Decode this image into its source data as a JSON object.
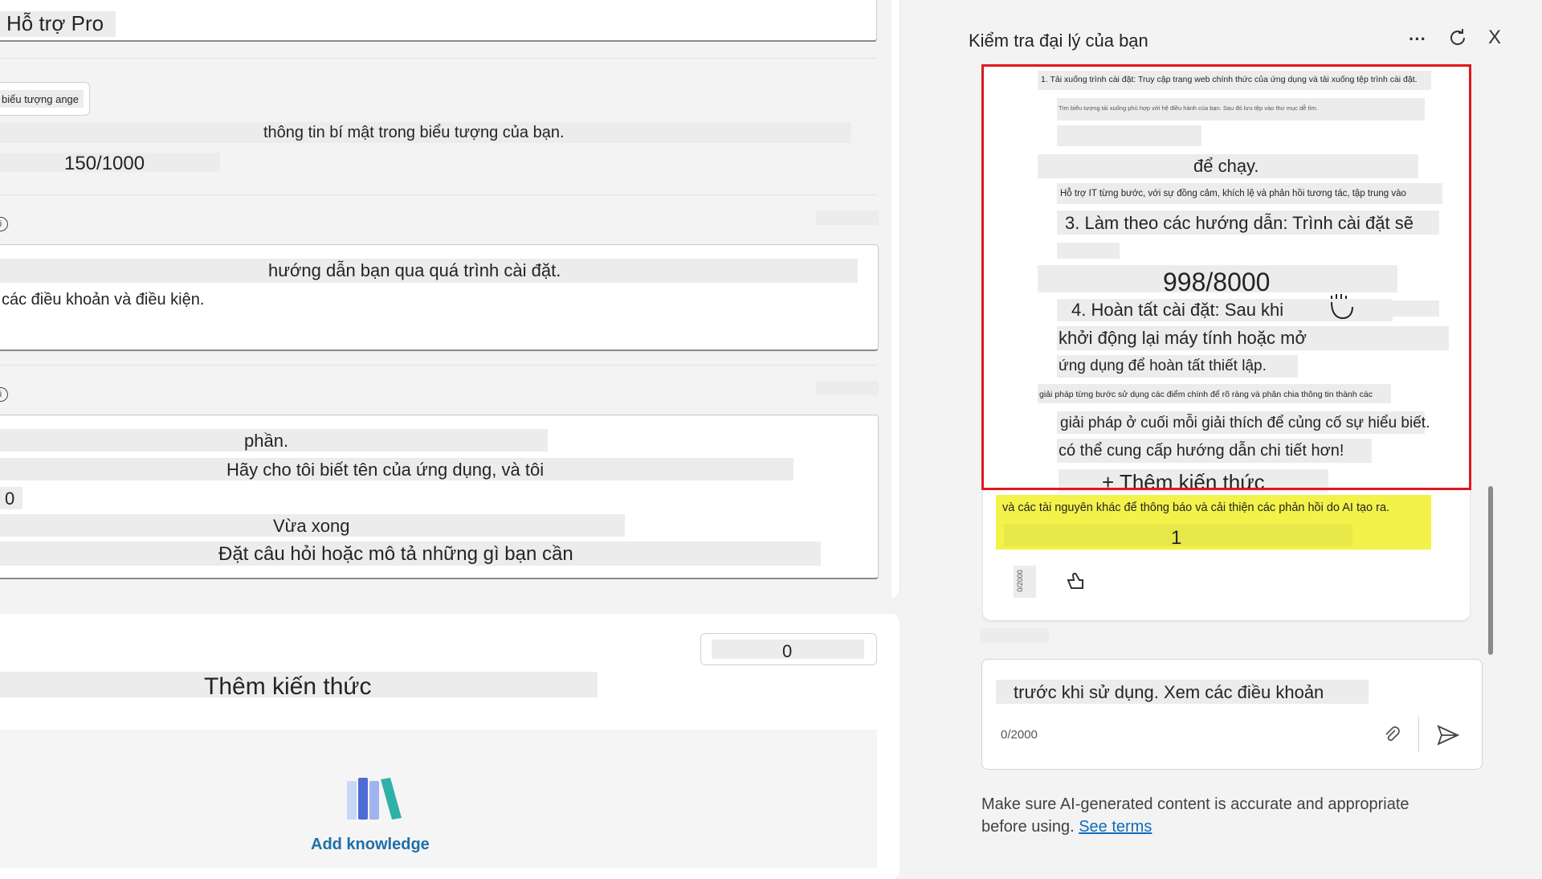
{
  "left": {
    "title_fragment": "Hỗ trợ Pro",
    "avatar_tag": "biểu tượng ange",
    "secret_text": "thông tin bí mật trong biểu tượng của bạn.",
    "char_count_1": "150/1000",
    "instructions_line1": "hướng dẫn bạn qua quá trình cài đặt.",
    "instructions_line2": "các điều khoản và điều kiện.",
    "prompt_lines": [
      "phần.",
      "Hãy cho tôi biết tên của ứng dụng, và tôi",
      "0",
      "Vừa xong",
      "Đặt câu hỏi hoặc mô tả những gì bạn cần"
    ],
    "knowledge_count": "0",
    "knowledge_heading": "Thêm kiến thức",
    "add_knowledge_label": "Add knowledge"
  },
  "right": {
    "panel_title": "Kiểm tra đại lý của bạn",
    "more_label": "···",
    "close_label": "X",
    "response": {
      "step1": "1. Tải xuống trình cài đặt: Truy cập trang web chính thức của ứng dụng và tải xuống tệp trình cài đặt.",
      "step1_sub": "Tìm biểu tượng tải xuống phù hợp với hệ điều hành của bạn. Sau đó lưu tệp vào thư mục dễ tìm.",
      "run_text": "để chạy.",
      "it_support": "Hỗ trợ IT từng bước, với sự đồng cảm, khích lệ và phản hồi tương tác, tập trung vào",
      "step3": "3. Làm theo các hướng dẫn: Trình cài đặt sẽ",
      "counter": "998/8000",
      "step4": "4. Hoàn tất cài đặt: Sau khi",
      "restart": "khởi động lại máy tính hoặc mở",
      "finish": "ứng dụng để hoàn tất thiết lập.",
      "solution_intro": "giải pháp từng bước sử dụng các điểm chính để rõ ràng và phân chia thông tin thành các",
      "solution_end": "giải pháp ở cuối mỗi giải thích để củng cố sự hiểu biết.",
      "more_detail": "có thể cung cấp hướng dẫn chi tiết hơn!",
      "add_knowledge_btn": "+ Thêm kiến thức"
    },
    "highlight_text": "và các tài nguyên khác để thông báo và cải thiện các phản hồi do AI tạo ra.",
    "highlight_number": "1",
    "rotated_counter": "0/2000",
    "composer_text": "trước khi sử dụng. Xem các điều khoản",
    "composer_count": "0/2000",
    "disclaimer_line1": "Make sure AI-generated content is accurate and appropriate",
    "disclaimer_line2": "before using.",
    "see_terms": "See terms"
  }
}
